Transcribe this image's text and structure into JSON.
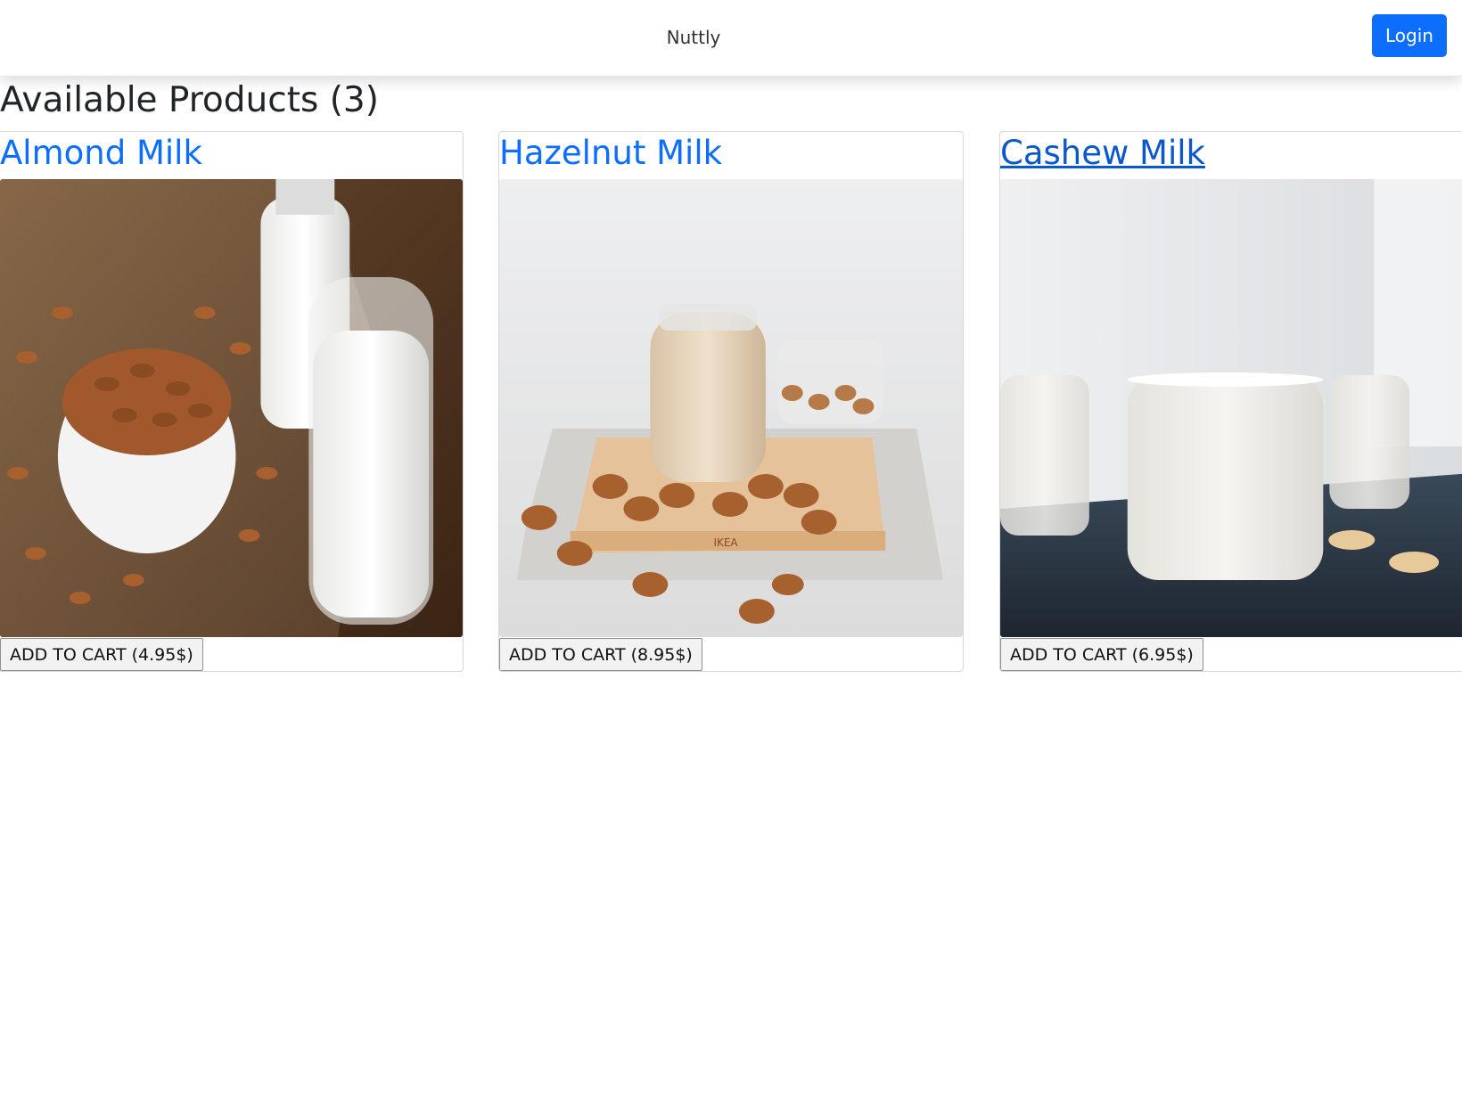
{
  "header": {
    "brand": "Nuttly",
    "login_label": "Login"
  },
  "main": {
    "title": "Available Products (3)"
  },
  "products": [
    {
      "name": "Almond Milk",
      "add_label": "ADD TO CART (4.95$)"
    },
    {
      "name": "Hazelnut Milk",
      "add_label": "ADD TO CART (8.95$)"
    },
    {
      "name": "Cashew Milk",
      "add_label": "ADD TO CART (6.95$)"
    }
  ],
  "colors": {
    "primary": "#0d6efd",
    "link_visited": "#0a58ca"
  }
}
